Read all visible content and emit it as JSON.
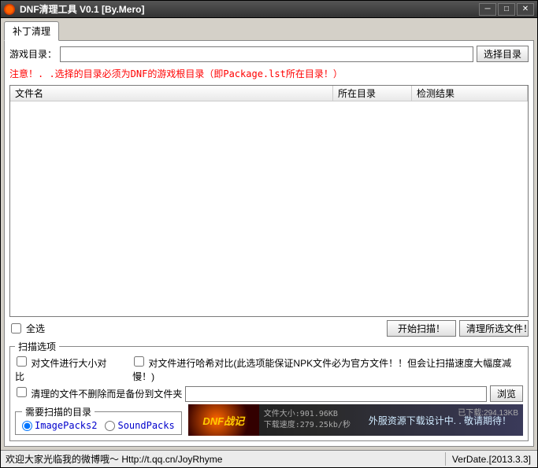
{
  "window": {
    "title": "DNF清理工具 V0.1 [By.Mero]"
  },
  "tab": {
    "label": "补丁清理"
  },
  "gamedir": {
    "label": "游戏目录：",
    "value": "",
    "browse_btn": "选择目录"
  },
  "warning_text": "注意！. .选择的目录必须为DNF的游戏根目录（即Package.lst所在目录！）",
  "list": {
    "cols": [
      "文件名",
      "所在目录",
      "检测结果"
    ]
  },
  "select_all": {
    "label": "全选"
  },
  "actions": {
    "scan_btn": "开始扫描！",
    "clean_btn": "清理所选文件！"
  },
  "scan_options": {
    "legend": "扫描选项",
    "size_check": "对文件进行大小对比",
    "hash_check": "对文件进行哈希对比(此选项能保证NPK文件必为官方文件！！但会让扫描速度大幅度减慢！)",
    "backup_check": "清理的文件不删除而是备份到文件夹",
    "backup_path": "",
    "browse_btn": "浏览"
  },
  "scan_target": {
    "legend": "需要扫描的目录",
    "opt1": "ImagePacks2",
    "opt2": "SoundPacks"
  },
  "banner": {
    "logo_text": "DNF战记",
    "filesize_label": "文件大小:",
    "filesize_value": "901.96KB",
    "dlspeed_label": "下载速度:",
    "dlspeed_value": "279.25kb/秒",
    "dlcount_label": "已下载:",
    "dlcount_value": "294.13KB",
    "promo": "外服资源下载设计中. . 敬请期待！"
  },
  "statusbar": {
    "left": "欢迎大家光临我的微博哦～ Http://t.qq.cn/JoyRhyme",
    "right": "VerDate.[2013.3.3]"
  }
}
